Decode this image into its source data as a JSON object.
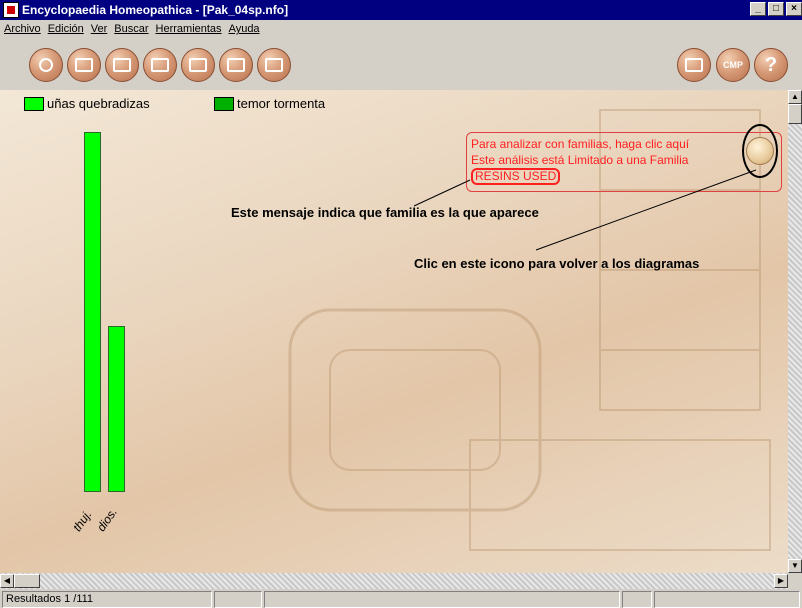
{
  "window": {
    "title": "Encyclopaedia Homeopathica - [Pak_04sp.nfo]"
  },
  "menu": [
    "Archivo",
    "Edición",
    "Ver",
    "Buscar",
    "Herramientas",
    "Ayuda"
  ],
  "toolbar": {
    "left_icons": [
      "search-icon",
      "home-icon",
      "books-icon",
      "document-icon",
      "open-book-icon",
      "list-icon",
      "chart-icon"
    ],
    "right_icons": [
      "gift-icon",
      "cmp-icon",
      "help-icon"
    ],
    "cmp_label": "CMP",
    "help_label": "?"
  },
  "legend": [
    {
      "label": "uñas quebradizas",
      "color": "#00ff00"
    },
    {
      "label": "temor tormenta",
      "color": "#00b000"
    }
  ],
  "chart_data": {
    "type": "bar",
    "categories": [
      "thuj.",
      "dios."
    ],
    "values": [
      100,
      46
    ],
    "colors": [
      "#00ff00",
      "#00ff00"
    ]
  },
  "info": {
    "line1": "Para analizar con familias, haga clic aquí",
    "line2": "Este análisis está Limitado a una Familia",
    "line3": "RESINS USED"
  },
  "annotations": {
    "family": "Este mensaje indica que familia es la que aparece",
    "icon": "Clic en este icono para volver a los diagramas"
  },
  "status": {
    "results": "Resultados 1 /111"
  }
}
